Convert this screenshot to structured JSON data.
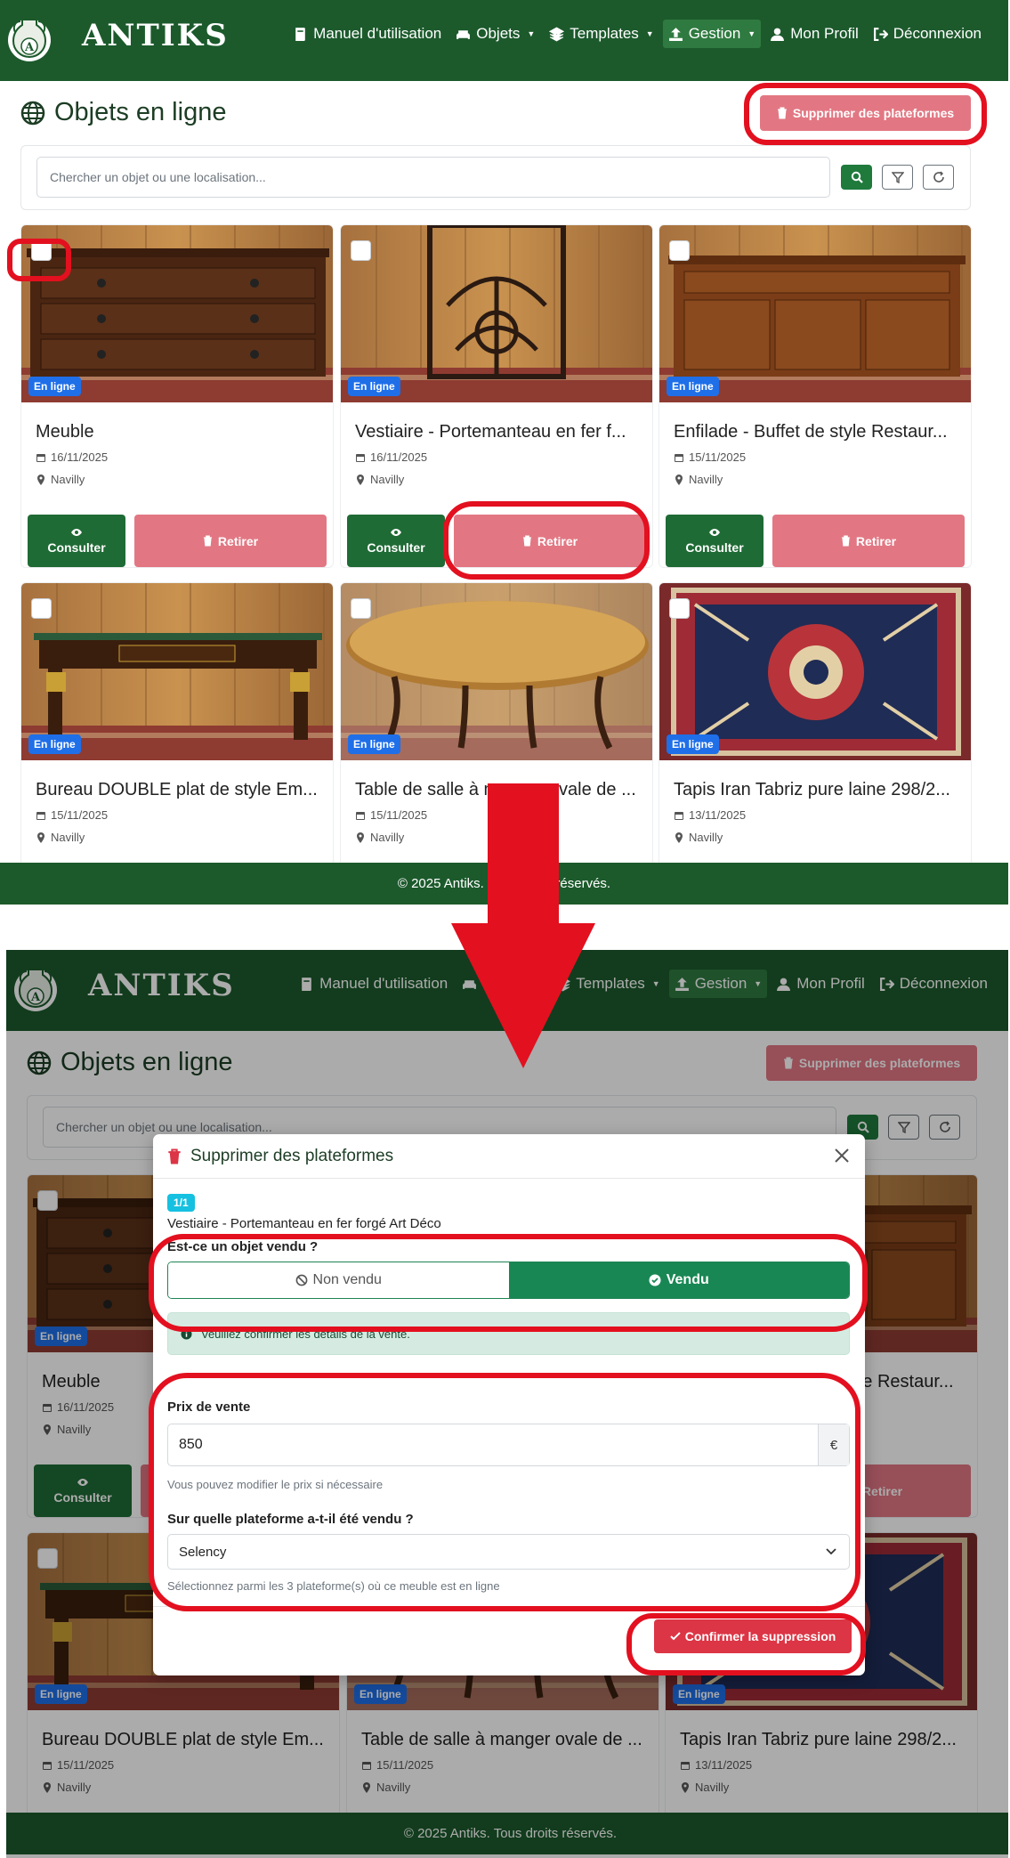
{
  "app": {
    "brand": "ANTIKS",
    "logo_letter": "A",
    "nav": [
      {
        "label": "Manuel d'utilisation",
        "icon": "book-icon",
        "dropdown": false,
        "active": false
      },
      {
        "label": "Objets",
        "icon": "couch-icon",
        "dropdown": true,
        "active": false
      },
      {
        "label": "Templates",
        "icon": "layers-icon",
        "dropdown": true,
        "active": false
      },
      {
        "label": "Gestion",
        "icon": "upload-icon",
        "dropdown": true,
        "active": true
      },
      {
        "label": "Mon Profil",
        "icon": "user-icon",
        "dropdown": false,
        "active": false
      },
      {
        "label": "Déconnexion",
        "icon": "logout-icon",
        "dropdown": false,
        "active": false
      }
    ],
    "footer": "© 2025 Antiks. Tous droits réservés."
  },
  "page": {
    "title": "Objets en ligne",
    "delete_platforms_label": "Supprimer des plateformes",
    "search_placeholder": "Chercher un objet ou une localisation..."
  },
  "items": [
    {
      "title": "Meuble",
      "date": "16/11/2025",
      "location": "Navilly",
      "badge": "En ligne"
    },
    {
      "title": "Vestiaire - Portemanteau en fer f...",
      "date": "16/11/2025",
      "location": "Navilly",
      "badge": "En ligne"
    },
    {
      "title": "Enfilade - Buffet de style Restaur...",
      "date": "15/11/2025",
      "location": "Navilly",
      "badge": "En ligne"
    },
    {
      "title": "Bureau DOUBLE plat de style Em...",
      "date": "15/11/2025",
      "location": "Navilly",
      "badge": "En ligne"
    },
    {
      "title": "Table de salle à manger ovale de ...",
      "date": "15/11/2025",
      "location": "Navilly",
      "badge": "En ligne"
    },
    {
      "title": "Tapis Iran Tabriz pure laine 298/2...",
      "date": "13/11/2025",
      "location": "Navilly",
      "badge": "En ligne"
    }
  ],
  "card_buttons": {
    "consult": "Consulter",
    "remove": "Retirer"
  },
  "modal": {
    "title": "Supprimer des plateformes",
    "counter": "1/1",
    "item_name": "Vestiaire - Portemanteau en fer forgé Art Déco",
    "question_sold": "Est-ce un objet vendu ?",
    "option_not_sold": "Non vendu",
    "option_sold": "Vendu",
    "selected": "Vendu",
    "alert": "Veuillez confirmer les détails de la vente.",
    "price_label": "Prix de vente",
    "price_value": "850",
    "currency": "€",
    "price_help": "Vous pouvez modifier le prix si nécessaire",
    "platform_label": "Sur quelle plateforme a-t-il été vendu ?",
    "platform_value": "Selency",
    "platform_help": "Sélectionnez parmi les 3 plateforme(s) où ce meuble est en ligne",
    "confirm_label": "Confirmer la suppression"
  },
  "colors": {
    "navbar": "#1c5a2c",
    "danger_soft": "#e27783",
    "danger": "#dc3545",
    "success": "#198754",
    "badge_blue": "#1f6fe8",
    "annotation_red": "#e3101f"
  }
}
